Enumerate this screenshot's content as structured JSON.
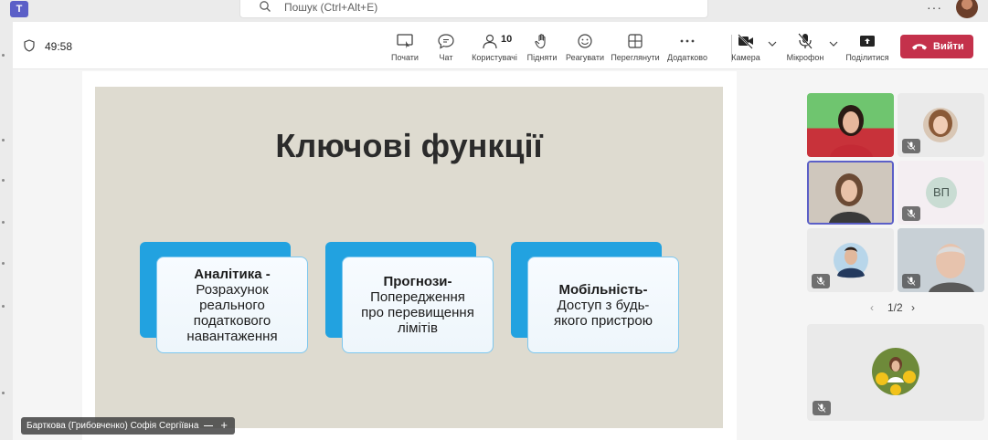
{
  "search": {
    "placeholder": "Пошук (Ctrl+Alt+E)"
  },
  "meeting": {
    "elapsed": "49:58"
  },
  "toolbar": {
    "share_start": "Почати",
    "chat": "Чат",
    "people": "Користувачі",
    "people_count": "10",
    "raise": "Підняти",
    "react": "Реагувати",
    "view": "Переглянути",
    "more": "Додатково",
    "camera": "Камера",
    "mic": "Мікрофон",
    "share": "Поділитися",
    "leave": "Вийти"
  },
  "slide": {
    "title": "Ключові функції",
    "cards": [
      {
        "head": "Аналітика -",
        "lines": [
          "Розрахунок",
          "реального",
          "податкового",
          "навантаження"
        ]
      },
      {
        "head": "Прогнози-",
        "lines": [
          "Попередження",
          "про перевищення",
          "лімітів"
        ]
      },
      {
        "head": "Мобільність-",
        "lines": [
          "Доступ з будь-",
          "якого пристрою"
        ]
      }
    ]
  },
  "presenter": {
    "name": "Барткова (Грибовченко) Софія Сергіївна"
  },
  "participants": {
    "initials_tile": "ВП",
    "page_indicator": "1/2"
  },
  "icons": [
    "teams-logo",
    "search-icon",
    "more-icon",
    "shield-icon",
    "share-screen-icon",
    "chat-icon",
    "people-icon",
    "hand-icon",
    "smile-icon",
    "grid-icon",
    "more-dots-icon",
    "camera-off-icon",
    "mic-off-icon",
    "share-tray-icon",
    "phone-icon"
  ],
  "colors": {
    "leave": "#c4314b",
    "brand": "#5b5fc7",
    "card_accent": "#22a2e0",
    "slide_bg": "#dedbd0"
  }
}
